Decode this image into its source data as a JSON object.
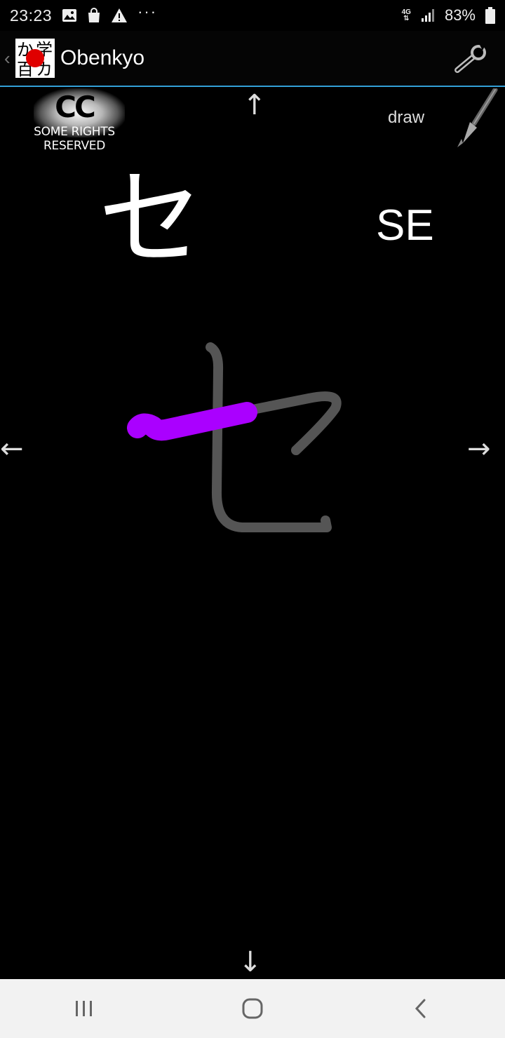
{
  "status_bar": {
    "time": "23:23",
    "network_type": "4G",
    "network_arrows": "⇅",
    "more": "···",
    "battery_percent": "83%"
  },
  "action_bar": {
    "up_caret": "‹",
    "app_name": "Obenkyo",
    "logo_chars": [
      "か",
      "学",
      "百",
      "カ"
    ],
    "settings_icon": "wrench-icon"
  },
  "license": {
    "cc_letters": "CC",
    "text": "SOME RIGHTS RESERVED"
  },
  "navigation": {
    "up": "↑",
    "down": "↓",
    "left": "←",
    "right": "→"
  },
  "draw": {
    "label": "draw",
    "icon": "brush-icon"
  },
  "card": {
    "kana": "セ",
    "romaji": "SE"
  },
  "stroke_colors": {
    "guide": "#555555",
    "active": "#aa00ff"
  }
}
